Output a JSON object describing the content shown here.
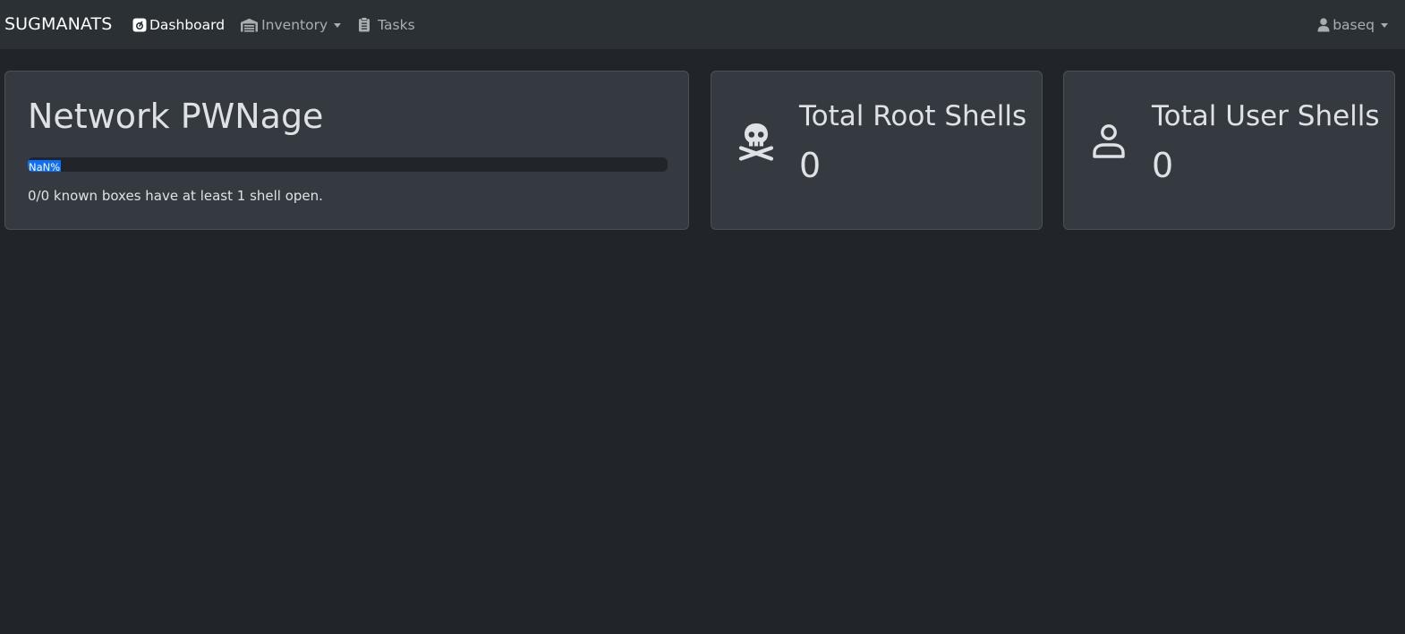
{
  "navbar": {
    "brand": "SUGMANATS",
    "links": [
      {
        "label": "Dashboard",
        "icon": "tachometer-icon",
        "active": true
      },
      {
        "label": "Inventory",
        "icon": "warehouse-icon",
        "dropdown": true
      },
      {
        "label": "Tasks",
        "icon": "clipboard-icon"
      }
    ],
    "user": {
      "label": "baseq",
      "icon": "user-icon"
    }
  },
  "cards": {
    "pwnage": {
      "title": "Network PWNage",
      "progress_label": "NaN%",
      "progress_accent": "#0d6efd",
      "description": "0/0 known boxes have at least 1 shell open."
    },
    "root_shells": {
      "title": "Total Root Shells",
      "value": "0",
      "icon": "skull-crossbones-icon"
    },
    "user_shells": {
      "title": "Total User Shells",
      "value": "0",
      "icon": "user-outline-icon"
    }
  },
  "colors": {
    "background": "#212529",
    "navbar": "#2b3035",
    "card": "#343a40",
    "text": "#dee2e6"
  }
}
